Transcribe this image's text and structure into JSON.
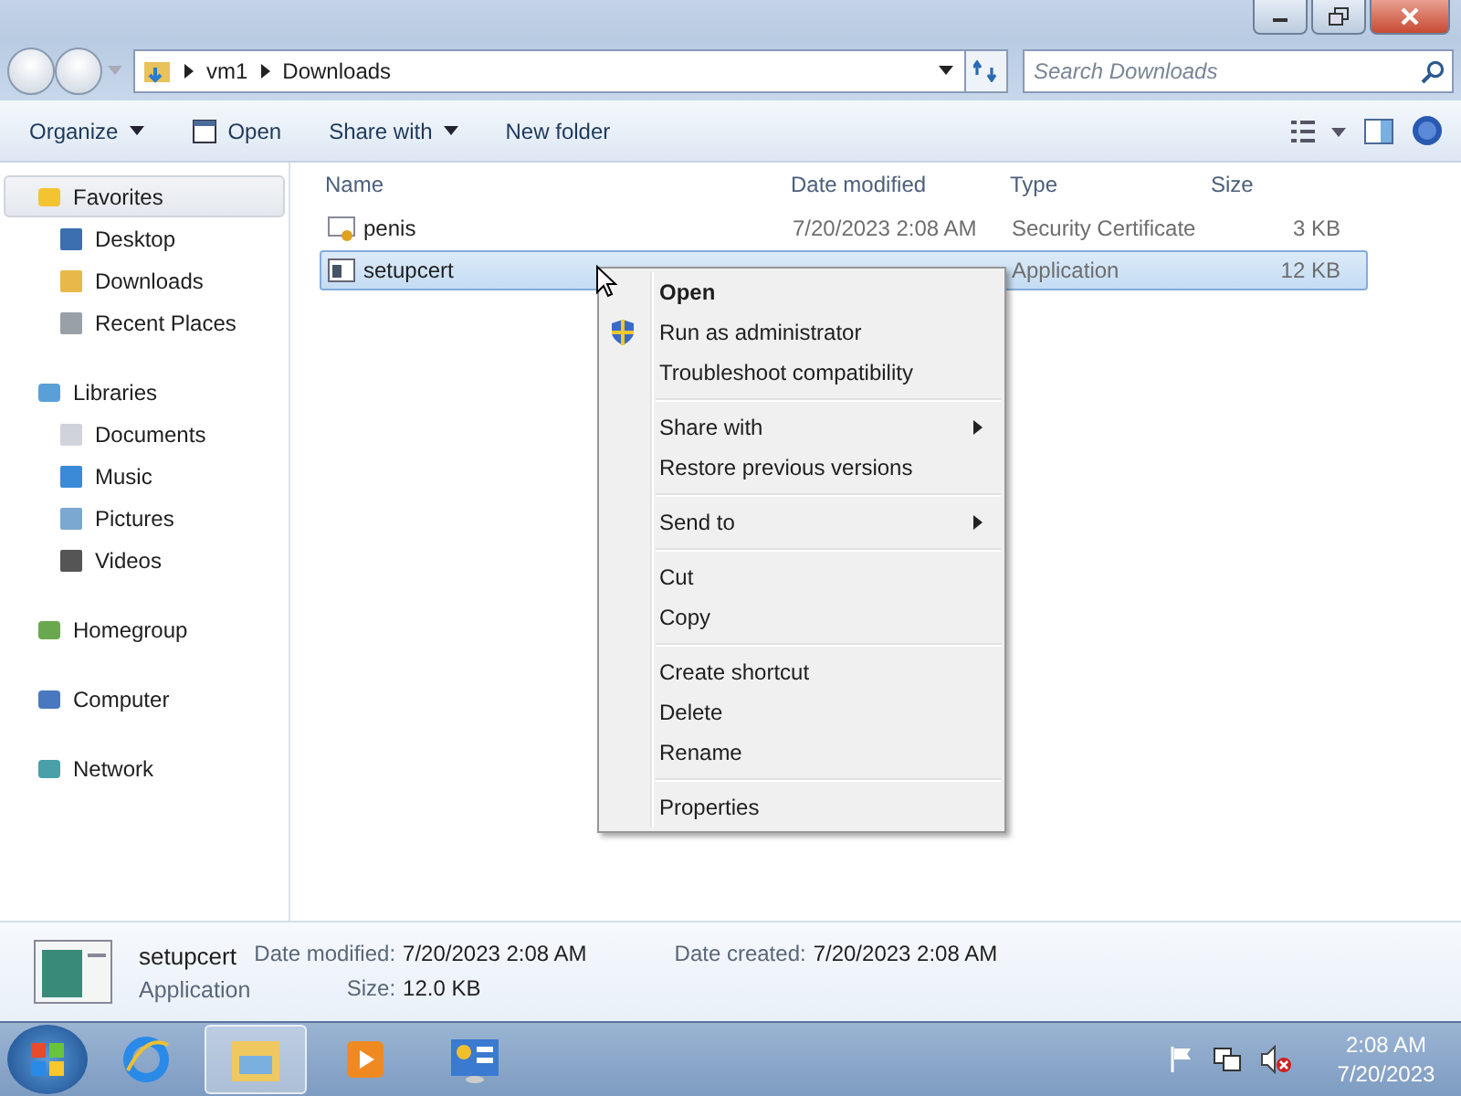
{
  "address": {
    "path": [
      "vm1",
      "Downloads"
    ]
  },
  "search": {
    "placeholder": "Search Downloads"
  },
  "toolbar": {
    "items": [
      {
        "label": "Organize",
        "kind": "menu"
      },
      {
        "label": "Open",
        "kind": "icon"
      },
      {
        "label": "Share with",
        "kind": "menu"
      },
      {
        "label": "New folder",
        "kind": "plain"
      }
    ]
  },
  "sidebar": {
    "groups": [
      {
        "label": "Favorites",
        "selected": true,
        "children": [
          {
            "label": "Desktop",
            "selected": false
          },
          {
            "label": "Downloads",
            "selected": false
          },
          {
            "label": "Recent Places",
            "selected": false
          }
        ]
      },
      {
        "label": "Libraries",
        "selected": false,
        "children": [
          {
            "label": "Documents",
            "selected": false
          },
          {
            "label": "Music",
            "selected": false
          },
          {
            "label": "Pictures",
            "selected": false
          },
          {
            "label": "Videos",
            "selected": false
          }
        ]
      },
      {
        "label": "Homegroup",
        "selected": false
      },
      {
        "label": "Computer",
        "selected": false
      },
      {
        "label": "Network",
        "selected": false
      }
    ]
  },
  "table": {
    "columns": [
      "Name",
      "Date modified",
      "Type",
      "Size"
    ],
    "rows": [
      {
        "name": "penis",
        "date": "7/20/2023 2:08 AM",
        "type": "Security Certificate",
        "size": "3 KB",
        "selected": false
      },
      {
        "name": "setupcert",
        "type": "Application",
        "size": "12 KB",
        "selected": true
      }
    ]
  },
  "context_menu": {
    "sections": [
      [
        {
          "label": "Open",
          "default": true,
          "submenu": false,
          "shield": false
        },
        {
          "label": "Run as administrator",
          "default": false,
          "submenu": false,
          "shield": true
        },
        {
          "label": "Troubleshoot compatibility",
          "default": false,
          "submenu": false,
          "shield": false
        }
      ],
      [
        {
          "label": "Share with",
          "default": false,
          "submenu": true,
          "shield": false
        },
        {
          "label": "Restore previous versions",
          "default": false,
          "submenu": false,
          "shield": false
        }
      ],
      [
        {
          "label": "Send to",
          "default": false,
          "submenu": true,
          "shield": false
        }
      ],
      [
        {
          "label": "Cut",
          "default": false,
          "submenu": false,
          "shield": false
        },
        {
          "label": "Copy",
          "default": false,
          "submenu": false,
          "shield": false
        }
      ],
      [
        {
          "label": "Create shortcut",
          "default": false,
          "submenu": false,
          "shield": false
        },
        {
          "label": "Delete",
          "default": false,
          "submenu": false,
          "shield": false
        },
        {
          "label": "Rename",
          "default": false,
          "submenu": false,
          "shield": false
        }
      ],
      [
        {
          "label": "Properties",
          "default": false,
          "submenu": false,
          "shield": false
        }
      ]
    ]
  },
  "details": {
    "name": "setupcert",
    "type": "Application",
    "fields": [
      {
        "label": "Date modified:",
        "value": "7/20/2023 2:08 AM"
      },
      {
        "label": "Date created:",
        "value": "7/20/2023 2:08 AM"
      },
      {
        "label": "Size:",
        "value": "12.0 KB"
      }
    ]
  },
  "taskbar": {
    "apps": [
      {
        "selected": false
      },
      {
        "selected": true
      },
      {
        "selected": false
      },
      {
        "selected": false
      }
    ],
    "clock": {
      "time": "2:08 AM",
      "date": "7/20/2023"
    }
  }
}
